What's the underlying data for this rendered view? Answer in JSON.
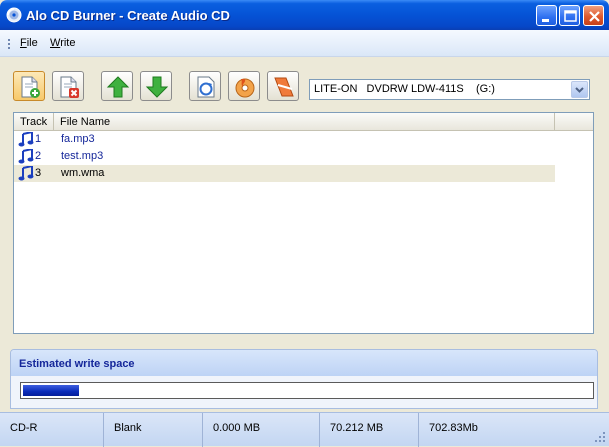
{
  "window": {
    "title": "Alo CD Burner  -  Create Audio CD",
    "minimize_icon": "minimize-icon",
    "maximize_icon": "maximize-icon",
    "close_icon": "close-icon"
  },
  "menu": {
    "items": [
      {
        "key": "F",
        "rest": "ile"
      },
      {
        "key": "W",
        "rest": "rite"
      }
    ]
  },
  "toolbar": {
    "buttons": [
      {
        "name": "add-file",
        "icon": "add-document-icon"
      },
      {
        "name": "remove-file",
        "icon": "delete-document-icon"
      },
      {
        "name": "move-up",
        "icon": "arrow-up-icon"
      },
      {
        "name": "move-down",
        "icon": "arrow-down-icon"
      },
      {
        "name": "refresh",
        "icon": "refresh-icon"
      },
      {
        "name": "burn",
        "icon": "burn-disc-icon"
      },
      {
        "name": "erase",
        "icon": "erase-icon"
      }
    ],
    "drive": {
      "selected": "LITE-ON   DVDRW LDW-411S    (G:)"
    }
  },
  "file_list": {
    "columns": [
      "Track",
      "File Name"
    ],
    "rows": [
      {
        "track": "1",
        "file": "fa.mp3",
        "selected": false
      },
      {
        "track": "2",
        "file": "test.mp3",
        "selected": false
      },
      {
        "track": "3",
        "file": "wm.wma",
        "selected": true
      }
    ]
  },
  "estimate": {
    "title": "Estimated write space",
    "progress_fraction": 0.098
  },
  "status": {
    "media": "CD-R",
    "state": "Blank",
    "used": "0.000 MB",
    "free": "70.212 MB",
    "capacity": "702.83Mb"
  },
  "colors": {
    "titlebar": "#0553d6",
    "accent_text": "#15279a",
    "progress": "#0a2bb8"
  }
}
